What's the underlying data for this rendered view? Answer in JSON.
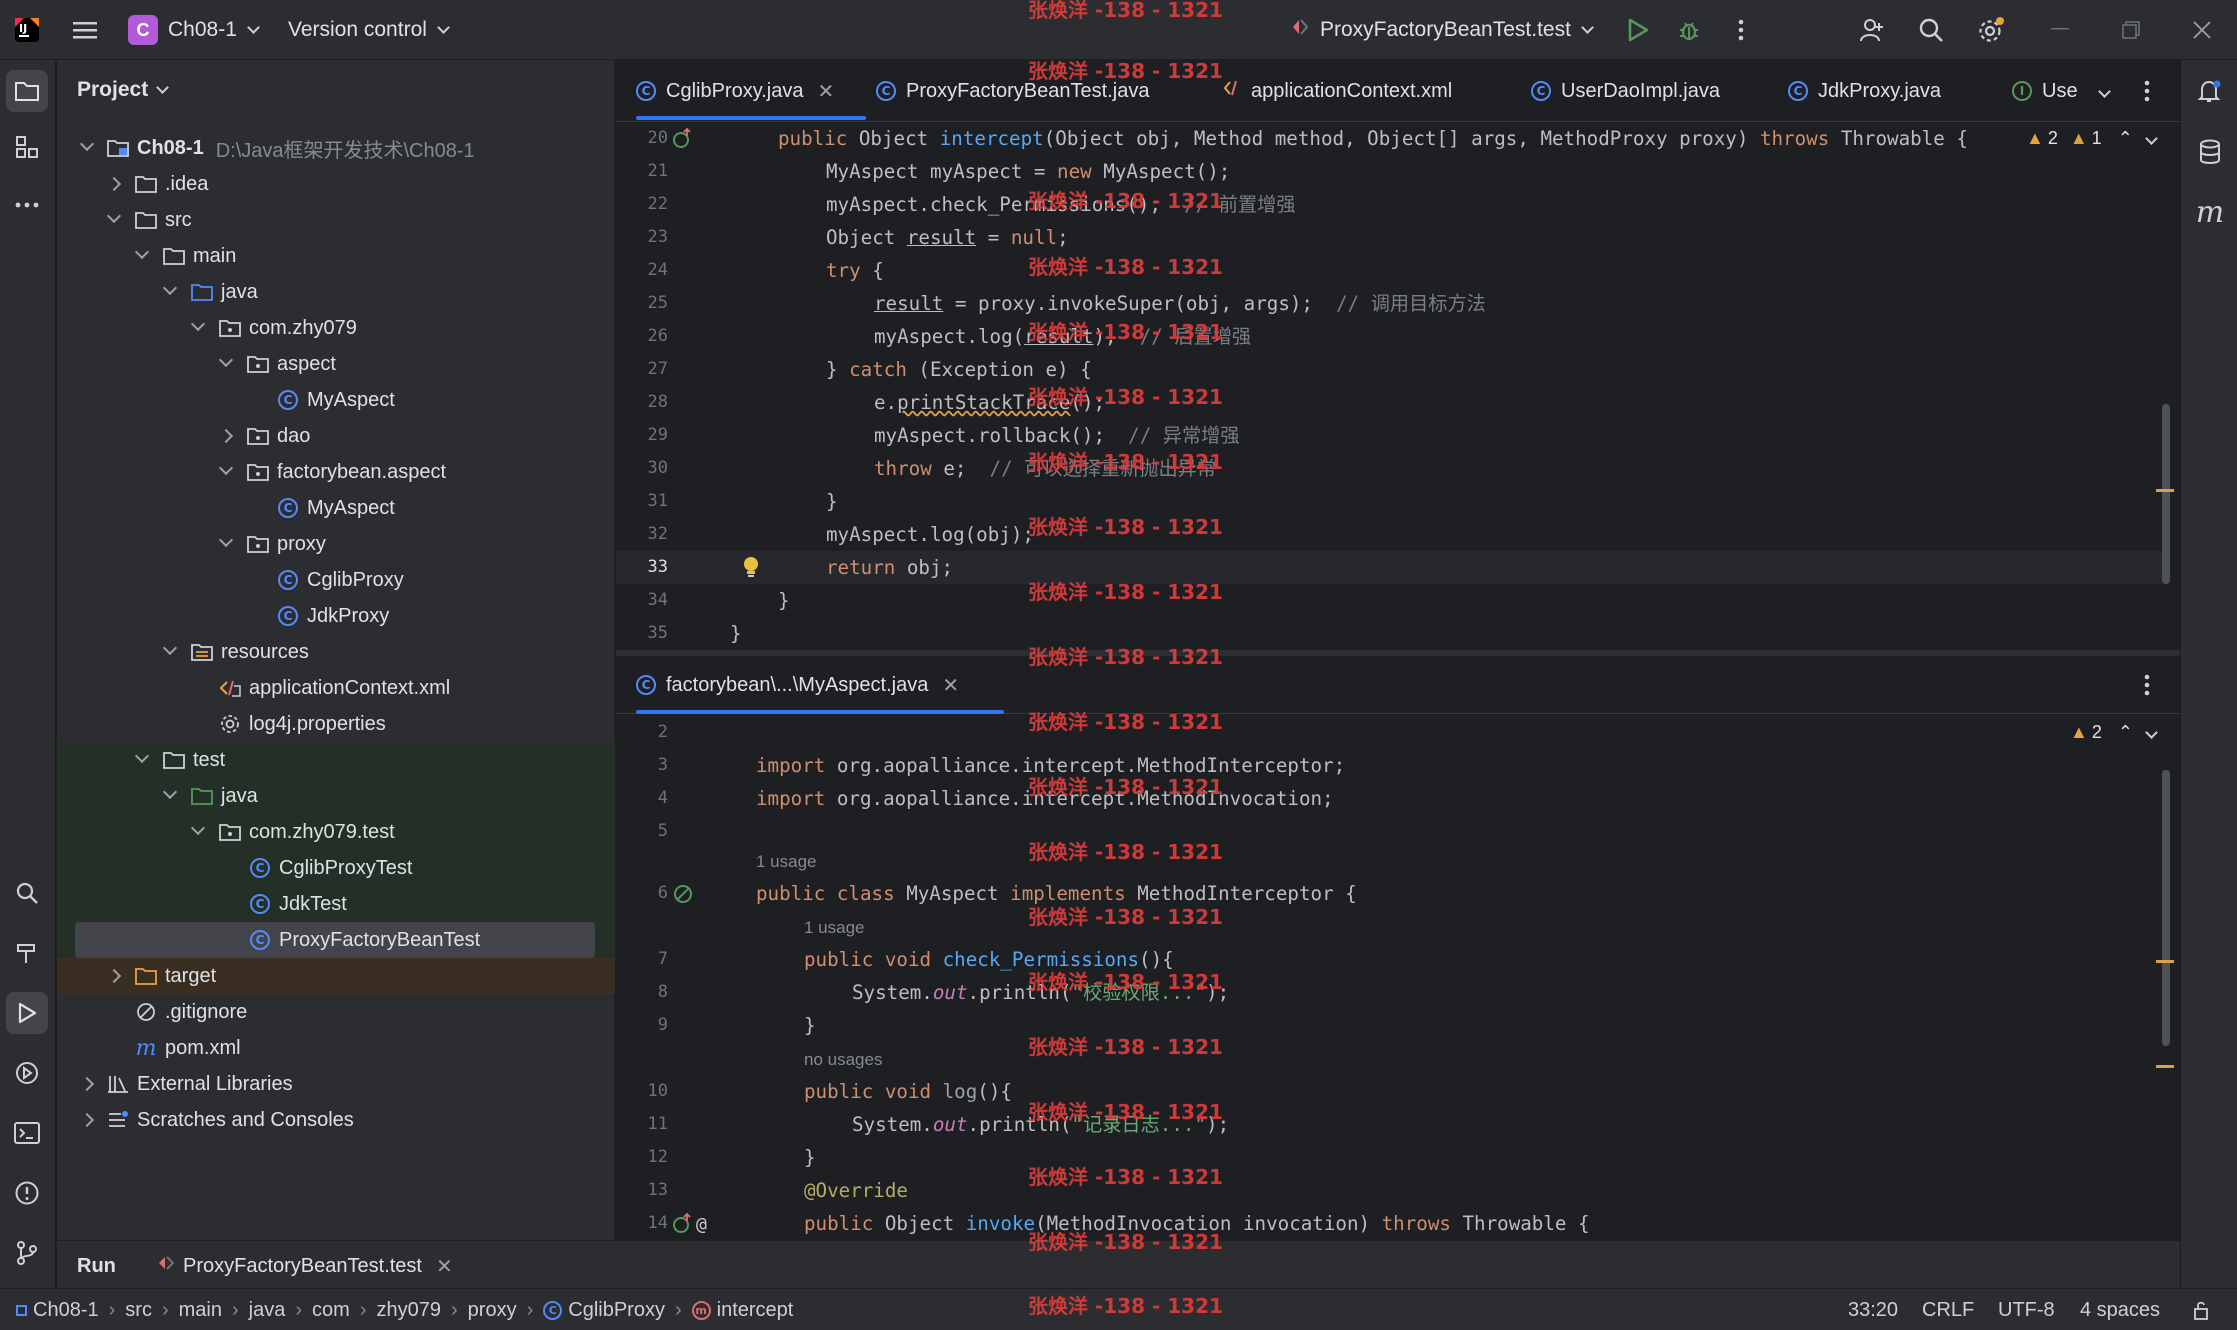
{
  "titlebar": {
    "project_name": "Ch08-1",
    "project_letter": "C",
    "vcs_label": "Version control",
    "run_config": "ProxyFactoryBeanTest.test"
  },
  "project_panel": {
    "title": "Project",
    "root_name": "Ch08-1",
    "root_path": "D:\\Java框架开发技术\\Ch08-1",
    "items": {
      "idea": ".idea",
      "src": "src",
      "main": "main",
      "java": "java",
      "pkg": "com.zhy079",
      "aspect": "aspect",
      "myaspect1": "MyAspect",
      "dao": "dao",
      "fb_aspect": "factorybean.aspect",
      "myaspect2": "MyAspect",
      "proxy": "proxy",
      "cglibproxy": "CglibProxy",
      "jdkproxy": "JdkProxy",
      "resources": "resources",
      "appctx": "applicationContext.xml",
      "log4j": "log4j.properties",
      "test": "test",
      "test_java": "java",
      "test_pkg": "com.zhy079.test",
      "cglibtest": "CglibProxyTest",
      "jdktest": "JdkTest",
      "pfbtest": "ProxyFactoryBeanTest",
      "target": "target",
      "gitignore": ".gitignore",
      "pom": "pom.xml",
      "extlib": "External Libraries",
      "scratches": "Scratches and Consoles"
    }
  },
  "editor_tabs": [
    "CglibProxy.java",
    "ProxyFactoryBeanTest.java",
    "applicationContext.xml",
    "UserDaoImpl.java",
    "JdkProxy.java",
    "Use"
  ],
  "editor_top": {
    "warnings_a": "2",
    "warnings_b": "1",
    "line_numbers": [
      "20",
      "21",
      "22",
      "23",
      "24",
      "25",
      "26",
      "27",
      "28",
      "29",
      "30",
      "31",
      "32",
      "33",
      "34",
      "35"
    ]
  },
  "editor_bottom": {
    "tab": "factorybean\\...\\MyAspect.java",
    "warnings": "2",
    "line_numbers": [
      "2",
      "3",
      "4",
      "5",
      "6",
      "7",
      "8",
      "9",
      "10",
      "11",
      "12",
      "13",
      "14"
    ],
    "hints": [
      "1 usage",
      "1 usage",
      "no usages"
    ]
  },
  "watermark": "张焕洋 -138 - 1321",
  "run_bar": {
    "label": "Run",
    "config": "ProxyFactoryBeanTest.test"
  },
  "statusbar": {
    "breadcrumbs": [
      "Ch08-1",
      "src",
      "main",
      "java",
      "com",
      "zhy079",
      "proxy",
      "CglibProxy",
      "intercept"
    ],
    "position": "33:20",
    "line_sep": "CRLF",
    "encoding": "UTF-8",
    "indent": "4 spaces"
  },
  "colors": {
    "accent": "#3574f0",
    "keyword": "#cf8e6d",
    "function": "#56a8f5",
    "string": "#6aab73",
    "comment": "#7a7e85",
    "watermark": "#d83b3b"
  }
}
